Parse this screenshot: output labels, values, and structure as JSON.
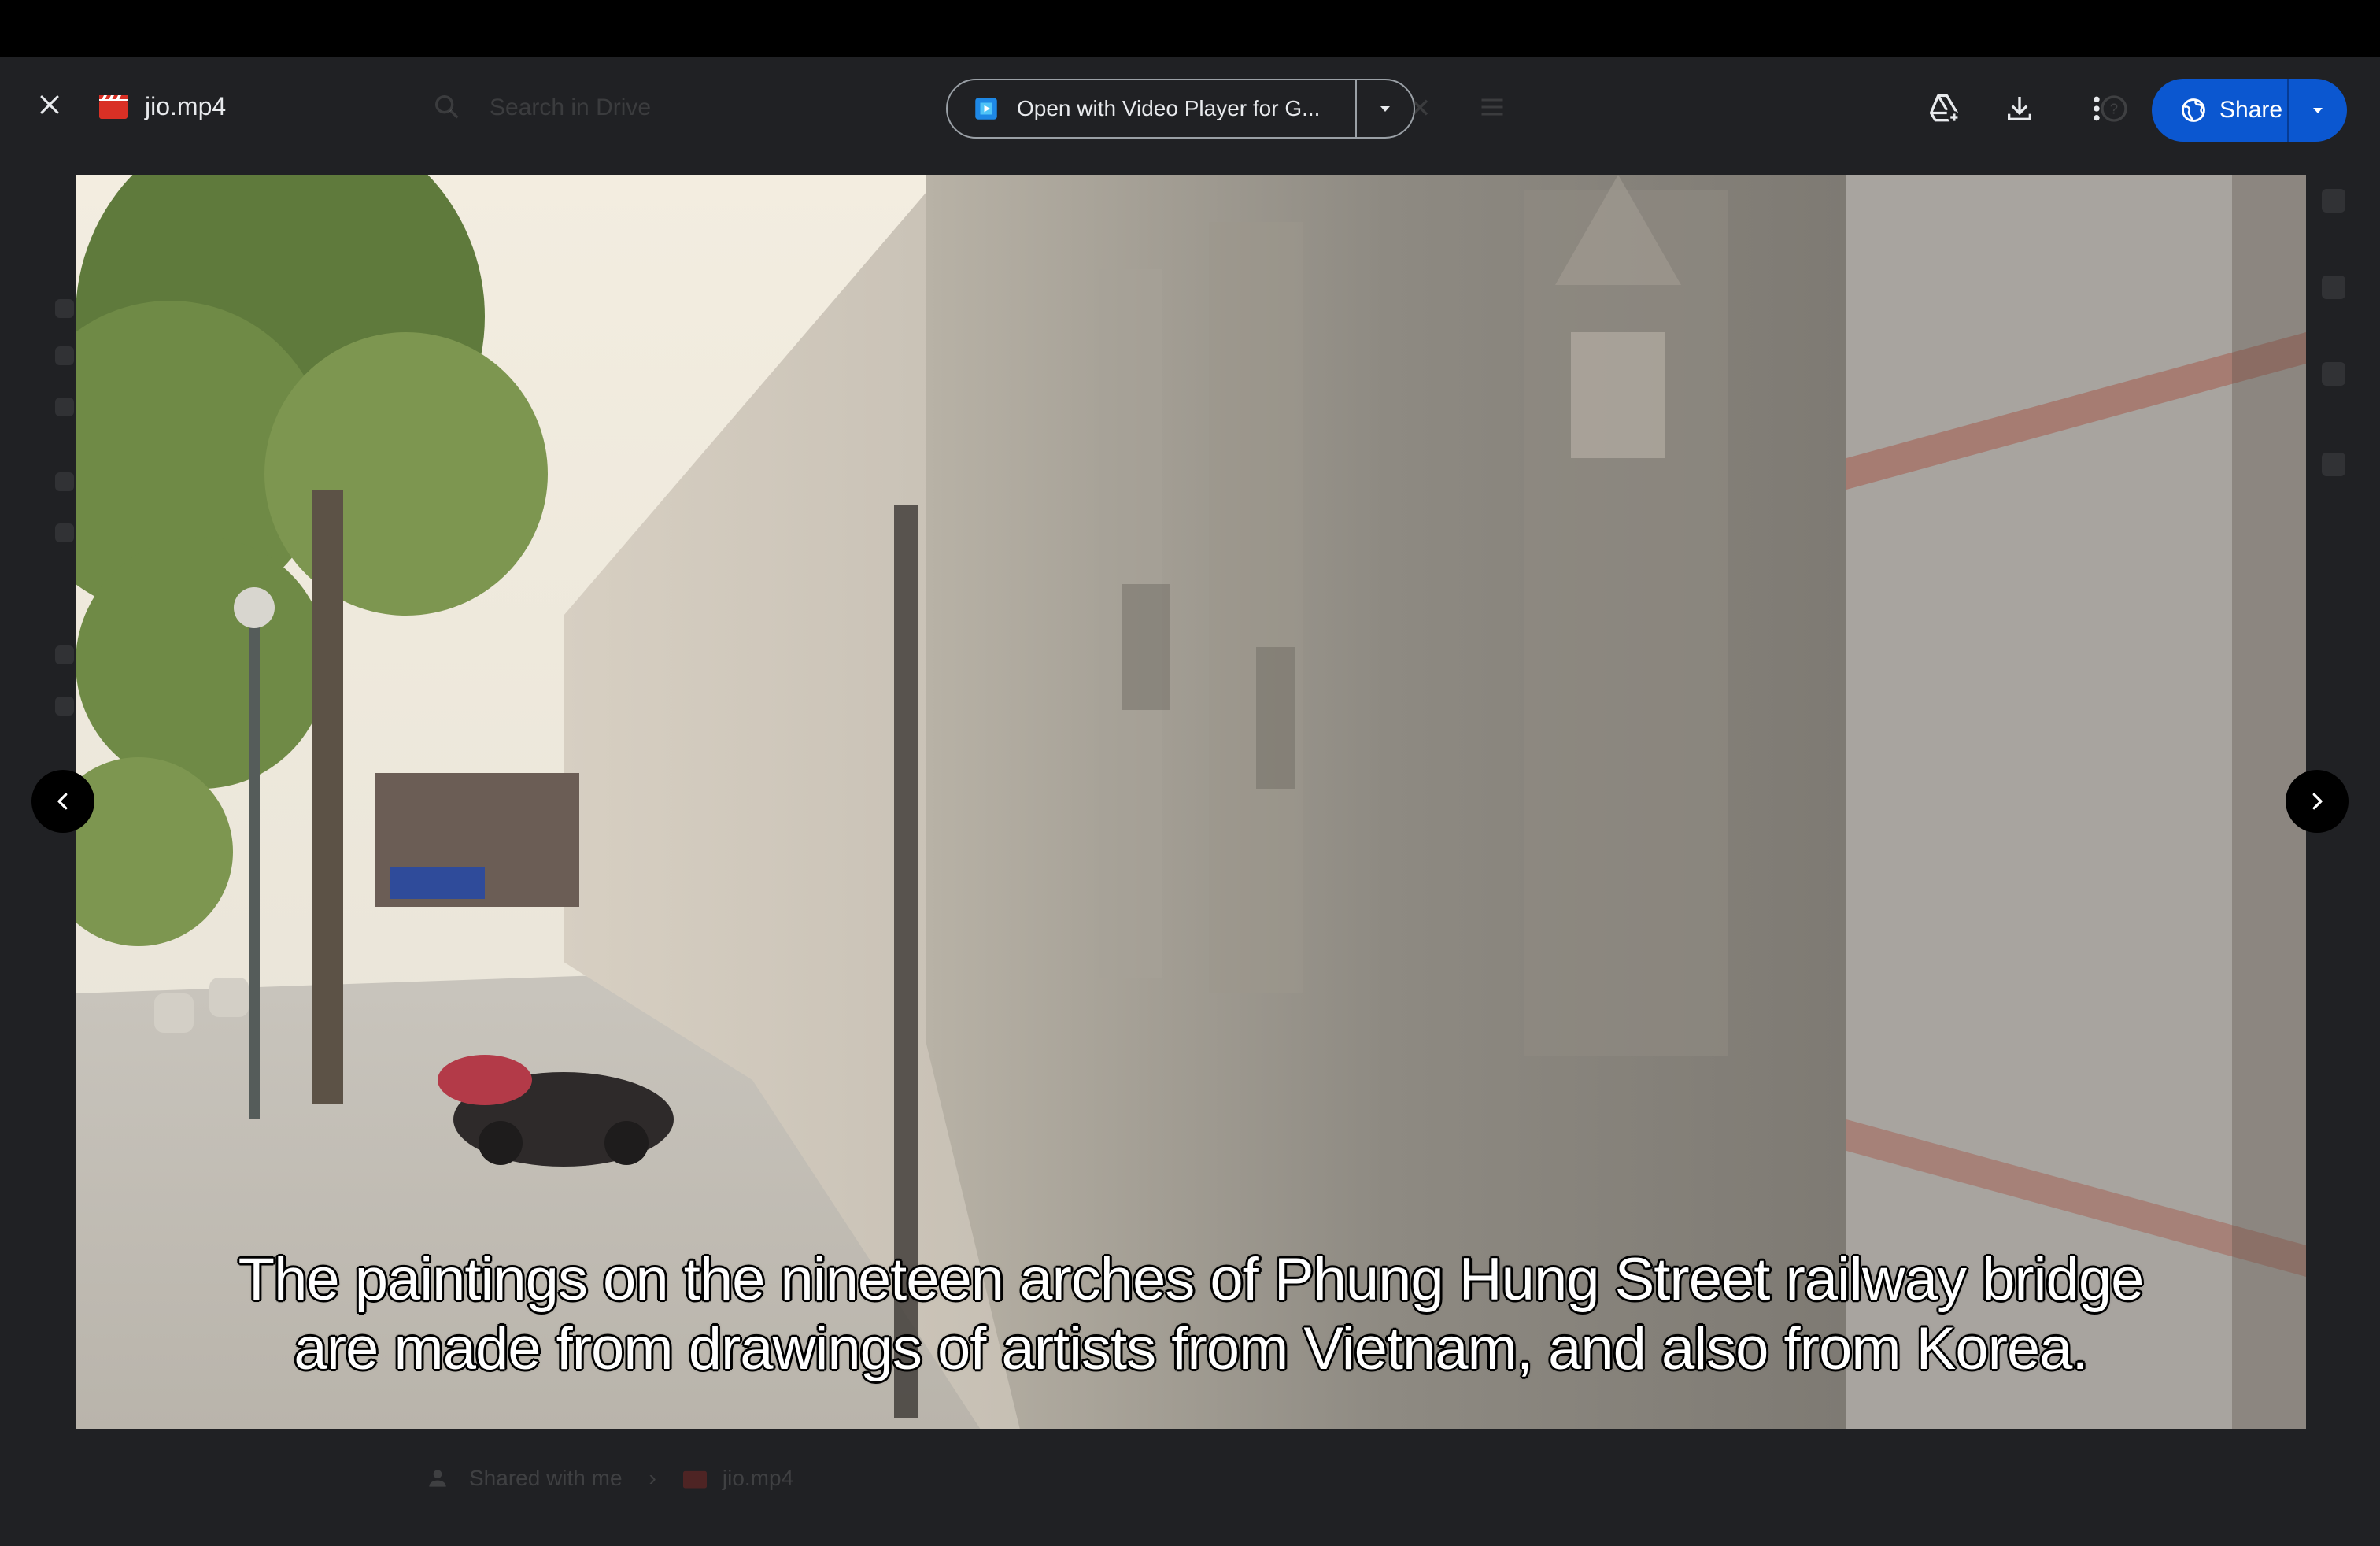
{
  "window": {
    "file_name": "jio.mp4"
  },
  "background_drive": {
    "search_placeholder": "Search in Drive",
    "breadcrumb": {
      "location": "Shared with me",
      "file": "jio.mp4"
    }
  },
  "toolbar": {
    "open_with_label": "Open with Video Player for G...",
    "share_label": "Share"
  },
  "video": {
    "subtitle_line1": "The paintings on the nineteen arches of Phung Hung Street railway bridge",
    "subtitle_line2": "are made from drawings of artists from Vietnam, and also from Korea."
  },
  "icons": {
    "close": "close-icon",
    "file_type": "video-file-icon",
    "open_with_app": "video-player-app-icon",
    "add_to_drive": "add-to-drive-icon",
    "download": "download-icon",
    "more": "more-vert-icon",
    "share": "globe-icon",
    "prev": "chevron-left-icon",
    "next": "chevron-right-icon"
  },
  "colors": {
    "share_button": "#0b57d0",
    "file_icon_red": "#d93025"
  }
}
